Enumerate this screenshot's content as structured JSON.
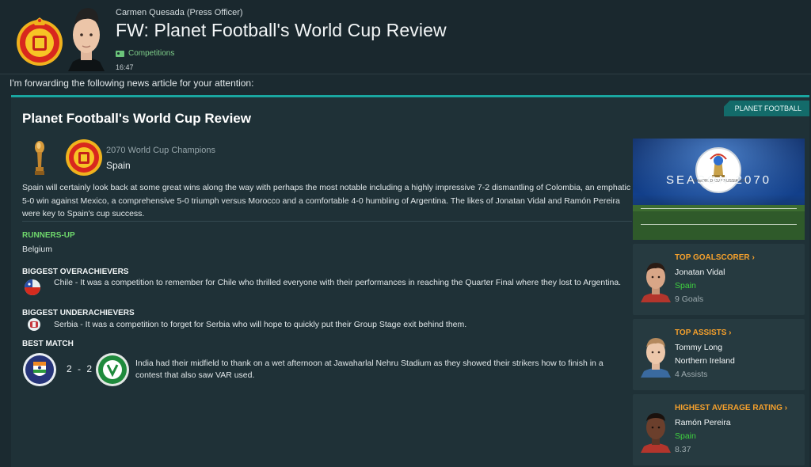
{
  "header": {
    "sender": "Carmen Quesada  (Press Officer)",
    "title": "FW: Planet Football's World Cup Review",
    "category": "Competitions",
    "time": "16:47"
  },
  "intro": "I'm forwarding the following news article for your attention:",
  "article": {
    "publication": "PLANET FOOTBALL",
    "title": "Planet Football's World Cup Review",
    "champion": {
      "subtitle": "2070 World Cup Champions",
      "team": "Spain"
    },
    "summary": "Spain will certainly look back at some great wins along the way with perhaps the most notable including a highly impressive 7-2 dismantling of Colombia, an emphatic 5-0 win against Mexico, a comprehensive 5-0 triumph versus Morocco and a comfortable 4-0 humbling of Argentina. The likes of Jonatan Vidal and Ramón Pereira were key to Spain's cup success.",
    "runners_up": {
      "heading": "RUNNERS-UP",
      "team": "Belgium"
    },
    "overachievers": {
      "heading": "BIGGEST OVERACHIEVERS",
      "text": "Chile - It was a competition to remember for Chile who thrilled everyone with their performances in reaching the Quarter Final where they lost to Argentina."
    },
    "underachievers": {
      "heading": "BIGGEST UNDERACHIEVERS",
      "text": "Serbia - It was a competition to forget for Serbia who will hope to quickly put their Group Stage exit behind them."
    },
    "best_match": {
      "heading": "BEST MATCH",
      "score": "2 - 2",
      "text": "India had their midfield to thank on a wet afternoon at Jawaharlal Nehru Stadium as they showed their strikers how to finish in a contest that also saw VAR used."
    }
  },
  "sidebar": {
    "season_label": "SEASON 2070",
    "logo_text": "FIFA WORLD CUP RUSSIA 2018",
    "top_goalscorer": {
      "heading": "TOP GOALSCORER",
      "name": "Jonatan Vidal",
      "team": "Spain",
      "value": "9 Goals"
    },
    "top_assists": {
      "heading": "TOP ASSISTS",
      "name": "Tommy Long",
      "team": "Northern Ireland",
      "value": "4 Assists"
    },
    "highest_rating": {
      "heading": "HIGHEST AVERAGE RATING",
      "name": "Ramón Pereira",
      "team": "Spain",
      "value": "8.37"
    }
  },
  "colors": {
    "accent": "#1aa6a0",
    "heading_orange": "#f6a12c",
    "green": "#3fd23f",
    "background": "#1b2a30"
  },
  "icons": {
    "chevron": "›"
  }
}
